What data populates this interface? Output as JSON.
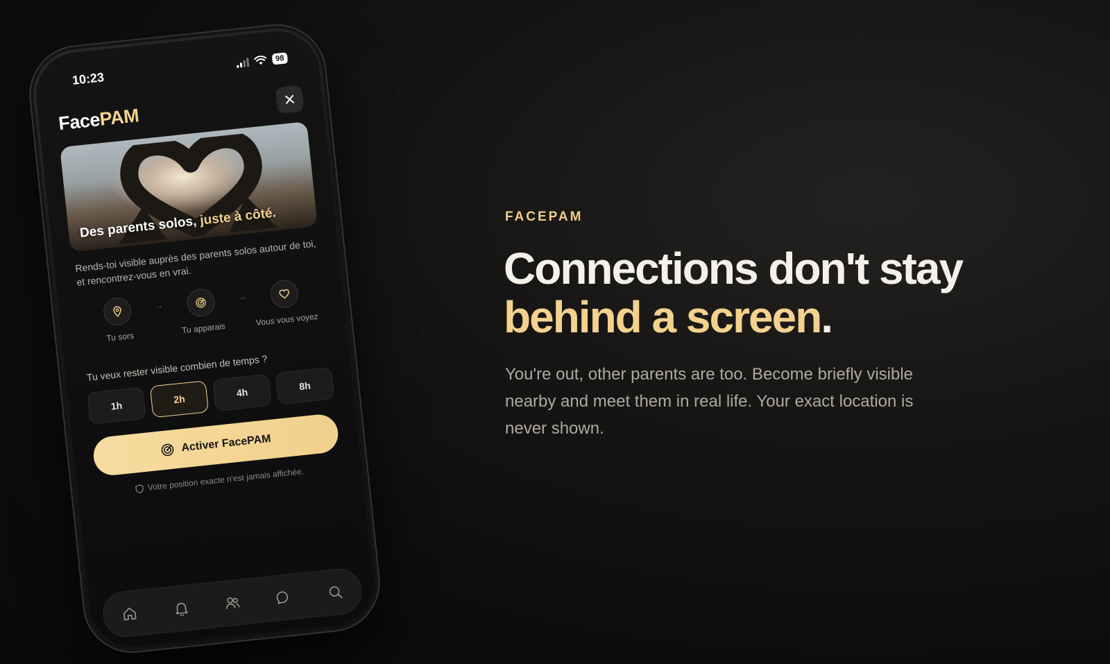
{
  "phone": {
    "status": {
      "time": "10:23",
      "battery": "98"
    },
    "logo": {
      "part1": "Face",
      "part2": "PAM"
    },
    "hero": {
      "title_part1": "Des parents solos, ",
      "title_part2": "juste à côté."
    },
    "intro": "Rends-toi visible auprès des parents solos autour de toi, et rencontrez-vous en vrai.",
    "steps": [
      {
        "label": "Tu sors",
        "icon": "location-pin-icon"
      },
      {
        "label": "Tu apparais",
        "icon": "radar-icon"
      },
      {
        "label": "Vous vous voyez",
        "icon": "heart-icon"
      }
    ],
    "duration_question": "Tu veux rester visible combien de temps ?",
    "durations": [
      "1h",
      "2h",
      "4h",
      "8h"
    ],
    "selected_duration": "2h",
    "activate_label": "Activer FacePAM",
    "privacy_note": "Votre position exacte n'est jamais affichée.",
    "tabs": [
      "home-icon",
      "bell-icon",
      "users-icon",
      "chat-icon",
      "search-icon"
    ]
  },
  "copy": {
    "eyebrow": "FACEPAM",
    "headline_line1": "Connections don't stay",
    "headline_line2": "behind a screen",
    "headline_dot": ".",
    "body": "You're out, other parents are too. Become briefly visible nearby and meet them in real life. Your exact location is never shown."
  },
  "colors": {
    "accent": "#f4d28e",
    "background": "#0d0d0d",
    "text": "#f4f1ea",
    "muted": "#aeaaa3"
  }
}
